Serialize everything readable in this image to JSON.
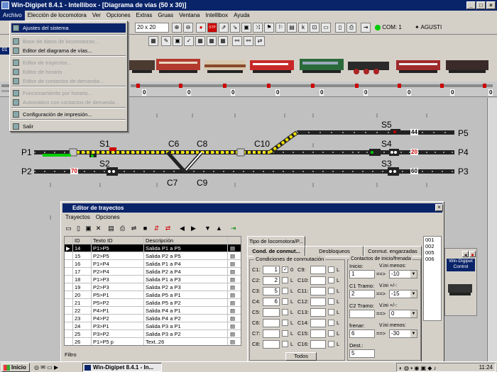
{
  "app": {
    "title": "Win-Digipet 8.4.1 - Intellibox - [Diagrama de vías (50 x 30)]",
    "menus": [
      "Archivo",
      "Elección de locomotora",
      "Ver",
      "Opciones",
      "Extras",
      "Gruas",
      "Ventana",
      "Intellibox",
      "Ayuda"
    ]
  },
  "toolbar": {
    "zoom": "20 x 20",
    "com_label": "COM: 1",
    "user_label": "AGUSTI"
  },
  "file_menu": {
    "items": [
      {
        "label": "Ajustes del sistema",
        "state": "selected"
      },
      {
        "label": "Base de datos de locomotoras...",
        "state": "disabled"
      },
      {
        "label": "Editor del diagrama de vías...",
        "state": "enabled"
      },
      {
        "label": "Editor de trayectos...",
        "state": "disabled"
      },
      {
        "label": "Editor de horario",
        "state": "disabled"
      },
      {
        "label": "Editor de contactos de demanda...",
        "state": "disabled"
      },
      {
        "label": "Funcionamiento por horario...",
        "state": "disabled"
      },
      {
        "label": "Automático con contactos de demanda...",
        "state": "disabled"
      },
      {
        "label": "Configuración de impresión...",
        "state": "enabled"
      },
      {
        "label": "Salir",
        "state": "enabled"
      }
    ]
  },
  "loco_bar": {
    "counters": [
      "0",
      "0",
      "0",
      "0",
      "0",
      "0",
      "0",
      "0",
      "0",
      "0"
    ],
    "row_number": "01"
  },
  "track": {
    "platforms": [
      "P1",
      "P2",
      "P3",
      "P4",
      "P5"
    ],
    "signals": [
      "S1",
      "S2",
      "S3",
      "S4",
      "S5"
    ],
    "switches": [
      "C6",
      "C7",
      "C8",
      "C9",
      "C10"
    ],
    "speed_badges": [
      "70",
      "20",
      "60",
      "44"
    ]
  },
  "route_editor": {
    "title": "Editor de trayectos",
    "menus": [
      "Trayectos",
      "Opciones"
    ],
    "columns": [
      "ID",
      "Texto ID",
      "Descripción"
    ],
    "rows": [
      {
        "id": "14",
        "text": "P1>P5",
        "desc": "Salida P1 a P5",
        "selected": true
      },
      {
        "id": "15",
        "text": "P2>P5",
        "desc": "Salida P2 a P5"
      },
      {
        "id": "16",
        "text": "P1>P4",
        "desc": "Salida P1 a P4"
      },
      {
        "id": "17",
        "text": "P2>P4",
        "desc": "Salida P2 a P4"
      },
      {
        "id": "18",
        "text": "P1>P3",
        "desc": "Salida P1 a P3"
      },
      {
        "id": "19",
        "text": "P2>P3",
        "desc": "Salida P2 a P3"
      },
      {
        "id": "20",
        "text": "P5>P1",
        "desc": "Salida P5 a P1"
      },
      {
        "id": "21",
        "text": "P5>P2",
        "desc": "Salida P5 a P2"
      },
      {
        "id": "22",
        "text": "P4>P1",
        "desc": "Salida P4 a P1"
      },
      {
        "id": "23",
        "text": "P4>P2",
        "desc": "Salida P4 a P2"
      },
      {
        "id": "24",
        "text": "P3>P1",
        "desc": "Salida P3 a P1"
      },
      {
        "id": "25",
        "text": "P3>P2",
        "desc": "Salida P3 a P2"
      },
      {
        "id": "26",
        "text": "P1>P5 p",
        "desc": "Text..26"
      }
    ],
    "filter_label": "Filtro",
    "tab_top": "Tipo de locomotora/P...",
    "tabs": [
      "Cond. de conmut...",
      "Desbloqueos",
      "Conmut. engarzadas"
    ],
    "cond_group": "Condiciones de conmutación",
    "conds": [
      {
        "label": "C1:",
        "value": "1",
        "flag": "0"
      },
      {
        "label": "C2:",
        "value": "2",
        "flag": "L"
      },
      {
        "label": "C3:",
        "value": "5",
        "flag": "L"
      },
      {
        "label": "C4:",
        "value": "6",
        "flag": "L"
      },
      {
        "label": "C5:",
        "value": "",
        "flag": "L"
      },
      {
        "label": "C6:",
        "value": "",
        "flag": "L"
      },
      {
        "label": "C7:",
        "value": "",
        "flag": "L"
      },
      {
        "label": "C8:",
        "value": "",
        "flag": "L"
      }
    ],
    "conds_right": [
      {
        "label": "C9:",
        "flag": "L"
      },
      {
        "label": "C10:",
        "flag": "L"
      },
      {
        "label": "C11:",
        "flag": "L"
      },
      {
        "label": "C12:",
        "flag": "L"
      },
      {
        "label": "C13:",
        "flag": "L"
      },
      {
        "label": "C14:",
        "flag": "L"
      },
      {
        "label": "C15:",
        "flag": "L"
      },
      {
        "label": "C16:",
        "flag": "L"
      }
    ],
    "all_button": "Todos",
    "contacts_group": "Contactos de inicio/frenada",
    "contacts": [
      {
        "label": "Inicio:",
        "value": "1",
        "vlabel": "V.ini menos:",
        "vvalue": "-10"
      },
      {
        "label": "C1 Tramo:",
        "value": "2",
        "vlabel": "V.ini +/-:",
        "vvalue": "-15"
      },
      {
        "label": "C2 Tramo:",
        "value": "",
        "vlabel": "V.ini +/-:",
        "vvalue": "0"
      },
      {
        "label": "frenar:",
        "value": "6",
        "vlabel": "V.ini menos:",
        "vvalue": "-30"
      },
      {
        "label": "Dest.:",
        "value": "5"
      }
    ],
    "arrow": "==>",
    "side_list": [
      "001",
      "002",
      "005",
      "006"
    ]
  },
  "control_panel": {
    "title": "Win-Digipet Control"
  },
  "taskbar": {
    "start": "Inicio",
    "task": "Win-Digipet 8.4.1 - In...",
    "time": "11:24"
  }
}
